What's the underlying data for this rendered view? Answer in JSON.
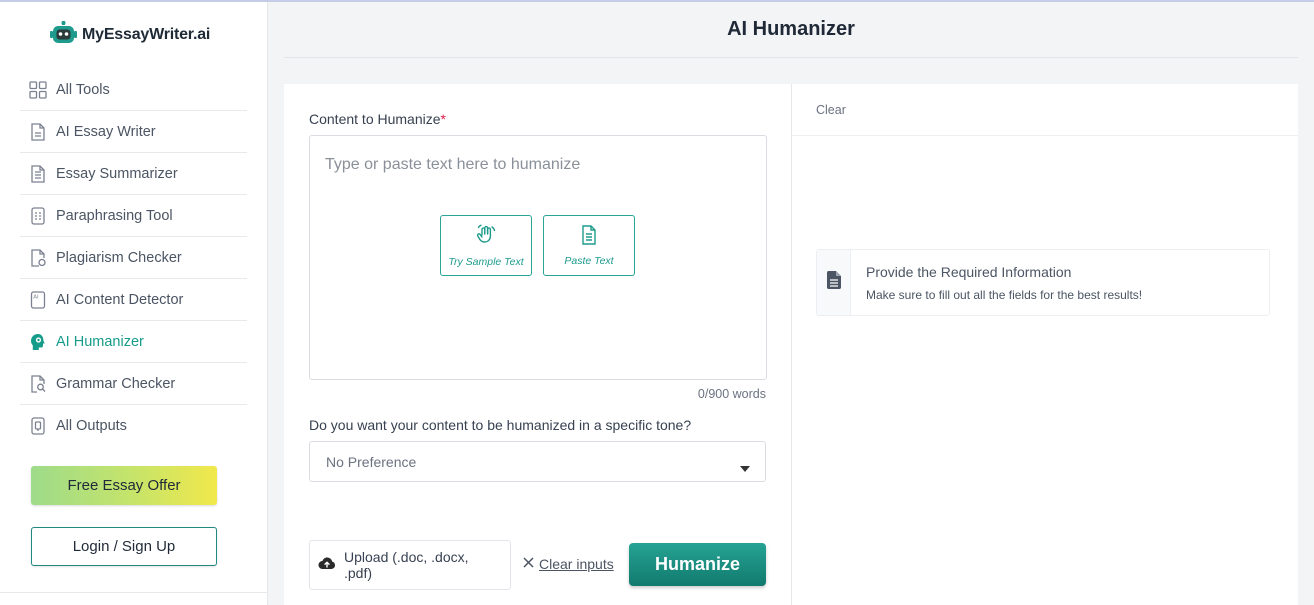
{
  "app": {
    "logo_text": "MyEssayWriter.ai",
    "page_title": "AI Humanizer"
  },
  "sidebar": {
    "items": [
      {
        "label": "All Tools",
        "icon": "grid-icon"
      },
      {
        "label": "AI Essay Writer",
        "icon": "document-icon"
      },
      {
        "label": "Essay Summarizer",
        "icon": "document-lines-icon"
      },
      {
        "label": "Paraphrasing Tool",
        "icon": "list-doc-icon"
      },
      {
        "label": "Plagiarism Checker",
        "icon": "document-check-icon"
      },
      {
        "label": "AI Content Detector",
        "icon": "ai-doc-icon"
      },
      {
        "label": "AI Humanizer",
        "icon": "head-icon",
        "active": true
      },
      {
        "label": "Grammar Checker",
        "icon": "doc-search-icon"
      },
      {
        "label": "All Outputs",
        "icon": "archive-icon"
      }
    ],
    "offer_label": "Free Essay Offer",
    "login_label": "Login / Sign Up"
  },
  "form": {
    "content_label": "Content to Humanize",
    "required_mark": "*",
    "placeholder": "Type or paste text here to humanize",
    "try_sample_label": "Try Sample Text",
    "paste_label": "Paste Text",
    "word_count": "0/900 words",
    "tone_question": "Do you want your content to be humanized in a specific tone?",
    "tone_value": "No Preference",
    "upload_label": "Upload (.doc, .docx, .pdf)",
    "clear_inputs_label": "Clear inputs",
    "humanize_label": "Humanize"
  },
  "output": {
    "clear_label": "Clear",
    "info_title": "Provide the Required Information",
    "info_sub": "Make sure to fill out all the fields for the best results!"
  },
  "colors": {
    "accent": "#169c8a",
    "button": "#1d8f83",
    "offer_gradient_start": "#9edb8a",
    "offer_gradient_end": "#f1e84b"
  }
}
